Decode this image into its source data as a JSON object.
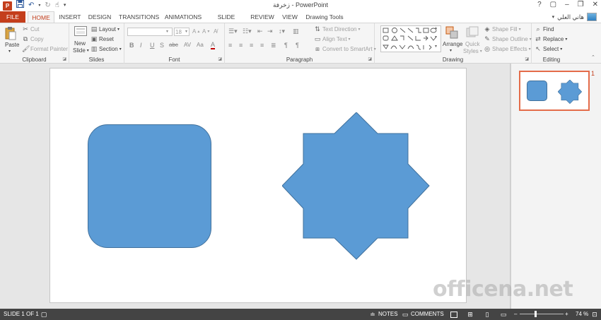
{
  "titlebar": {
    "title": "زخرفة - PowerPoint",
    "qat_icons": [
      "powerpoint-logo",
      "save-icon",
      "undo-icon",
      "redo-icon",
      "touch-mode-icon",
      "customize-icon"
    ],
    "window_controls": [
      "?",
      "▢",
      "–",
      "❐",
      "✕"
    ]
  },
  "tabs": {
    "file": "FILE",
    "home": "HOME",
    "insert": "INSERT",
    "design": "DESIGN",
    "transitions": "TRANSITIONS",
    "animations": "ANIMATIONS",
    "slideshow": "SLIDE SHOW",
    "review": "REVIEW",
    "view": "VIEW",
    "drawing_tools": "Drawing Tools"
  },
  "user": {
    "name": "هاني العلي"
  },
  "ribbon": {
    "clipboard": {
      "label": "Clipboard",
      "paste": "Paste",
      "cut": "Cut",
      "copy": "Copy",
      "format_painter": "Format Painter"
    },
    "slides": {
      "label": "Slides",
      "new_slide_1": "New",
      "new_slide_2": "Slide",
      "layout": "Layout",
      "reset": "Reset",
      "section": "Section"
    },
    "font": {
      "label": "Font",
      "size": "18",
      "bold": "B",
      "italic": "I",
      "underline": "U",
      "strike": "S",
      "shadow": "abc",
      "spacing": "AV",
      "case": "Aa",
      "color": "A"
    },
    "paragraph": {
      "label": "Paragraph",
      "text_direction": "Text Direction",
      "align_text": "Align Text",
      "convert_smartart": "Convert to SmartArt"
    },
    "drawing": {
      "label": "Drawing",
      "arrange": "Arrange",
      "quick_styles_1": "Quick",
      "quick_styles_2": "Styles",
      "shape_fill": "Shape Fill",
      "shape_outline": "Shape Outline",
      "shape_effects": "Shape Effects"
    },
    "editing": {
      "label": "Editing",
      "find": "Find",
      "replace": "Replace",
      "select": "Select"
    }
  },
  "thumbnail": {
    "number": "1"
  },
  "colors": {
    "accent": "#c43e1c",
    "shape_fill": "#5b9bd5",
    "shape_border": "#41719c",
    "thumb_border": "#e46c4a"
  },
  "watermark": "officena.net",
  "status": {
    "slide": "SLIDE 1 OF 1",
    "notes": "NOTES",
    "comments": "COMMENTS",
    "zoom": "74 %",
    "zoom_level_percent": 74
  }
}
